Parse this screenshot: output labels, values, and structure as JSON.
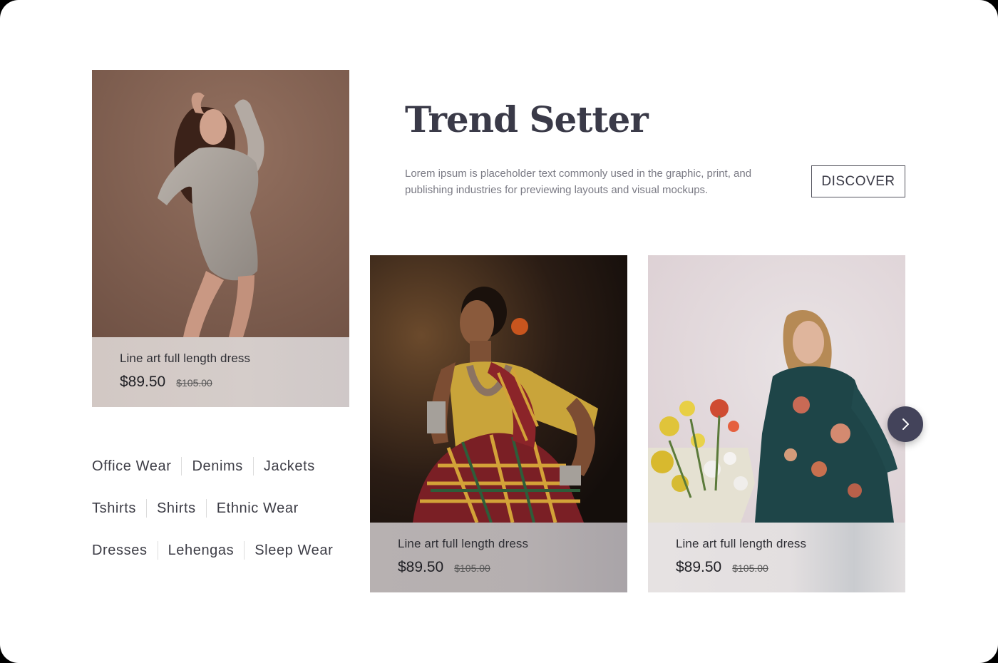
{
  "hero": {
    "title": "Trend Setter",
    "description": "Lorem ipsum is placeholder text commonly used in the graphic, print, and publishing industries for previewing layouts and visual mockups.",
    "cta_label": "DISCOVER"
  },
  "products": [
    {
      "name": "Line art full length dress",
      "price": "$89.50",
      "old_price": "$105.00"
    },
    {
      "name": "Line art full length dress",
      "price": "$89.50",
      "old_price": "$105.00"
    },
    {
      "name": "Line art full length dress",
      "price": "$89.50",
      "old_price": "$105.00"
    }
  ],
  "categories": [
    [
      "Office Wear",
      "Denims",
      "Jackets"
    ],
    [
      "Tshirts",
      "Shirts",
      "Ethnic Wear"
    ],
    [
      "Dresses",
      "Lehengas",
      "Sleep Wear"
    ]
  ],
  "icons": {
    "next": "chevron-right-icon"
  },
  "colors": {
    "accent": "#43435a",
    "title": "#3a3a48"
  }
}
